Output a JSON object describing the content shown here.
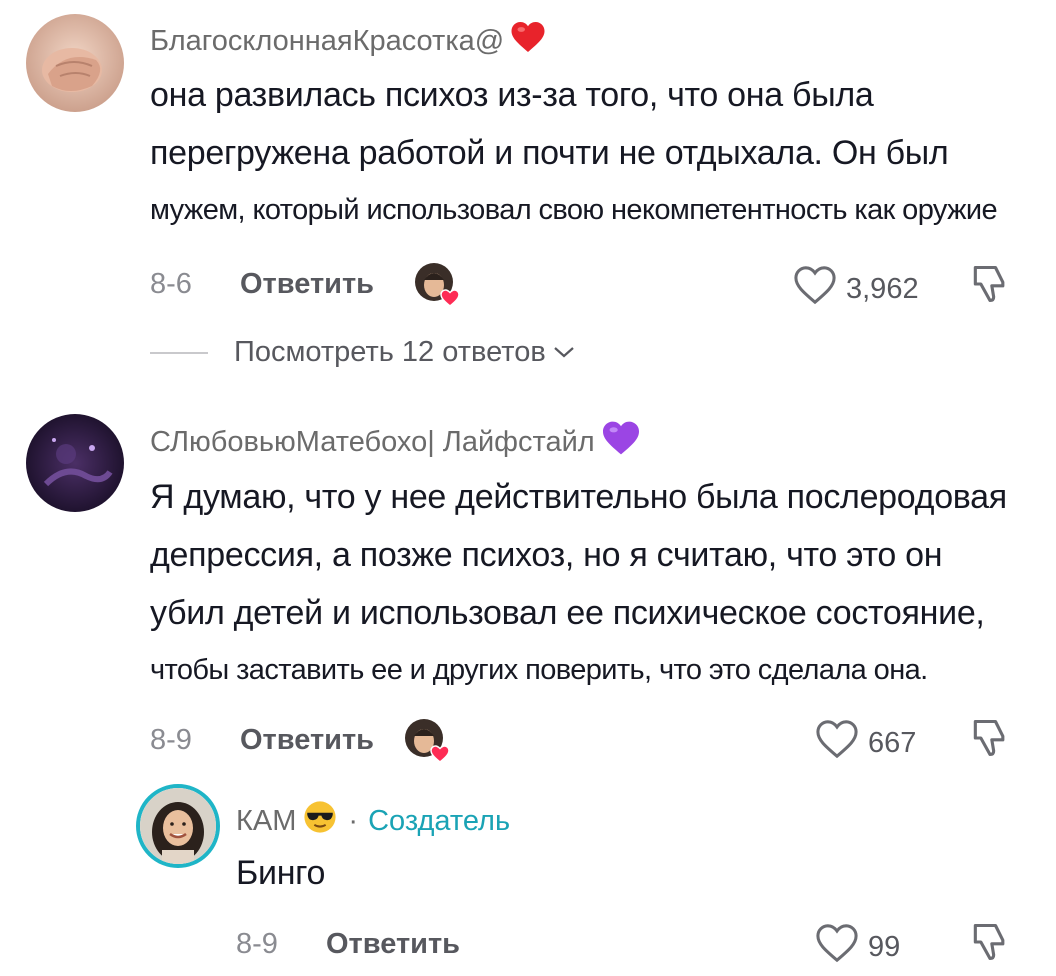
{
  "comments": [
    {
      "username": "БлагосклоннаяКрасотка@",
      "username_emoji": "red-heart",
      "lines": [
        "она развилась психоз из-за того, что она была",
        "перегружена работой и почти не отдыхала. Он был",
        "мужем, который использовал свою некомпетентность как оружие"
      ],
      "date": "8-6",
      "reply_label": "Ответить",
      "likes": "3,962",
      "view_replies": "Посмотреть 12 ответов"
    },
    {
      "username": "СЛюбовьюМатебохо| Лайфстайл",
      "username_emoji": "purple-heart",
      "lines": [
        "Я думаю, что у нее действительно была послеродовая",
        "депрессия, а позже психоз, но я считаю, что это он",
        "убил детей и использовал ее психическое состояние,",
        "чтобы заставить ее и других поверить, что это сделала она."
      ],
      "date": "8-9",
      "reply_label": "Ответить",
      "likes": "667"
    }
  ],
  "reply": {
    "username": "КАМ",
    "username_emoji": "sunglasses-face",
    "separator": "·",
    "creator_label": "Создатель",
    "text": "Бинго",
    "date": "8-9",
    "reply_label": "Ответить",
    "likes": "99"
  },
  "colors": {
    "text": "#161823",
    "muted": "#8a8b91",
    "creator": "#1aa3b5",
    "heart_red": "#fe2c55",
    "heart_purple": "#9b45e4"
  }
}
